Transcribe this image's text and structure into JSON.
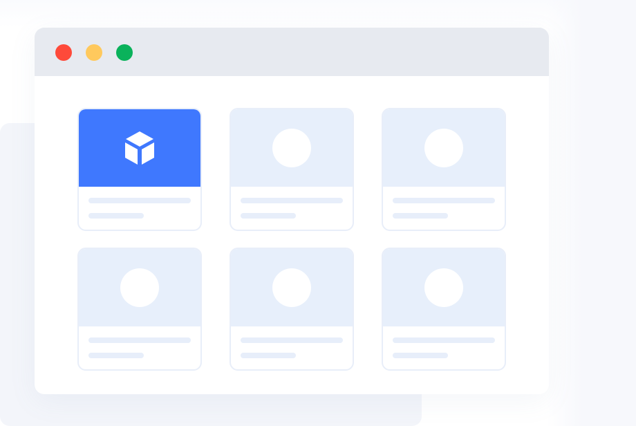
{
  "window": {
    "traffic_lights": [
      {
        "name": "close",
        "color": "#fe4a3a"
      },
      {
        "name": "minimize",
        "color": "#ffc95d"
      },
      {
        "name": "maximize",
        "color": "#0ab25b"
      }
    ]
  },
  "colors": {
    "accent": "#3f78fe",
    "titlebar": "#e7eaf0",
    "card_media": "#e7effb",
    "card_border": "#e8eef9",
    "placeholder_line": "#e7eefa",
    "background_panel": "#f3f5fa"
  },
  "cards": [
    {
      "selected": true,
      "icon": "cube-icon"
    },
    {
      "selected": false,
      "icon": "placeholder-circle"
    },
    {
      "selected": false,
      "icon": "placeholder-circle"
    },
    {
      "selected": false,
      "icon": "placeholder-circle"
    },
    {
      "selected": false,
      "icon": "placeholder-circle"
    },
    {
      "selected": false,
      "icon": "placeholder-circle"
    }
  ]
}
